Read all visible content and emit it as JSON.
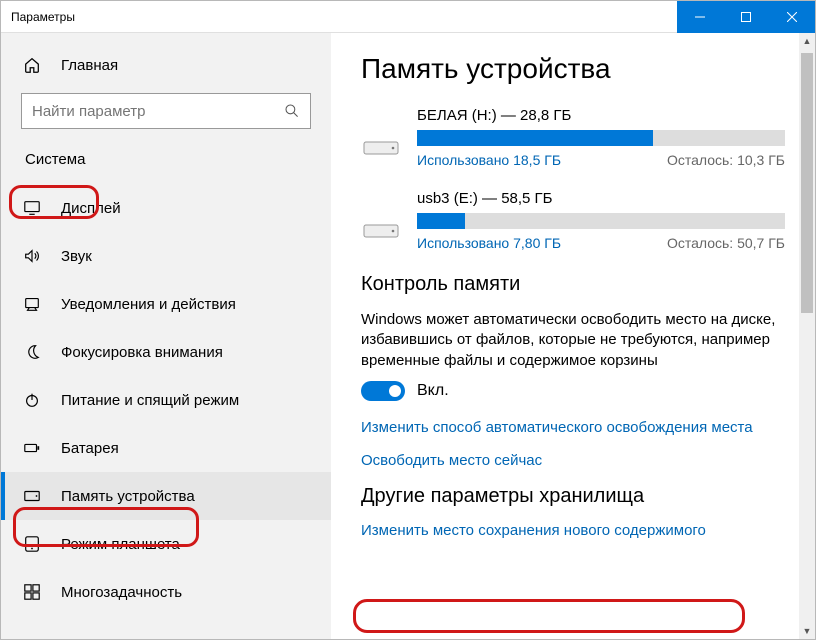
{
  "titlebar": {
    "title": "Параметры"
  },
  "sidebar": {
    "home": "Главная",
    "search_placeholder": "Найти параметр",
    "category": "Система",
    "items": [
      {
        "label": "Дисплей"
      },
      {
        "label": "Звук"
      },
      {
        "label": "Уведомления и действия"
      },
      {
        "label": "Фокусировка внимания"
      },
      {
        "label": "Питание и спящий режим"
      },
      {
        "label": "Батарея"
      },
      {
        "label": "Память устройства"
      },
      {
        "label": "Режим планшета"
      },
      {
        "label": "Многозадачность"
      }
    ]
  },
  "main": {
    "title": "Память устройства",
    "drives": [
      {
        "name": "БЕЛАЯ (H:) — 28,8 ГБ",
        "used_label": "Использовано 18,5 ГБ",
        "remain_label": "Осталось: 10,3 ГБ",
        "fill_pct": 64
      },
      {
        "name": "usb3 (E:) — 58,5 ГБ",
        "used_label": "Использовано 7,80 ГБ",
        "remain_label": "Осталось: 50,7 ГБ",
        "fill_pct": 13
      }
    ],
    "storage_sense": {
      "heading": "Контроль памяти",
      "desc": "Windows может автоматически освободить место на диске, избавившись от файлов, которые не требуются, например временные файлы и содержимое корзины",
      "toggle_label": "Вкл.",
      "link_configure": "Изменить способ автоматического освобождения места",
      "link_free_now": "Освободить место сейчас"
    },
    "more": {
      "heading": "Другие параметры хранилища",
      "link_change_loc": "Изменить место сохранения нового содержимого"
    }
  }
}
